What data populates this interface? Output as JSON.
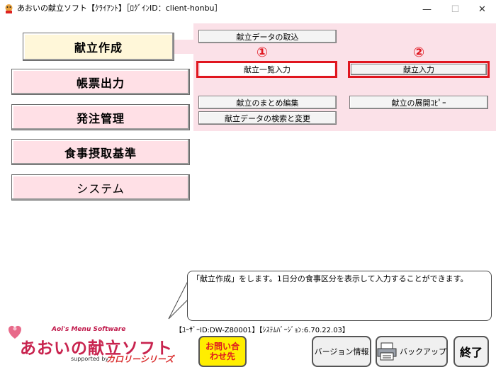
{
  "window": {
    "title": "あおいの献立ソフト【ｸﾗｲｱﾝﾄ】［ﾛｸﾞｲﾝID：client-honbu］",
    "minimize_glyph": "—",
    "maximize_glyph": "☐",
    "close_glyph": "✕"
  },
  "menu": {
    "items": [
      {
        "label": "献立作成"
      },
      {
        "label": "帳票出力"
      },
      {
        "label": "発注管理"
      },
      {
        "label": "食事摂取基準"
      },
      {
        "label": "システム"
      }
    ]
  },
  "submenu": {
    "import_label": "献立データの取込",
    "list_input_label": "献立一覧入力",
    "input_label": "献立入力",
    "bulk_edit_label": "献立のまとめ編集",
    "expand_copy_label": "献立の展開ｺﾋﾟｰ",
    "search_change_label": "献立データの検索と変更",
    "marker_1": "①",
    "marker_2": "②",
    "highlight_color": "#e0161f"
  },
  "hint": {
    "text": "「献立作成」をします。1日分の食事区分を表示して入力することができます。"
  },
  "status": {
    "user_info": "【ﾕｰｻﾞｰID:DW-Z80001】【ｼｽﾃﾑﾊﾞｰｼﾞｮﾝ:6.70.22.03】"
  },
  "logo": {
    "english": "Aoi's Menu Software",
    "japanese": "あおいの献立ソフト",
    "supported_by": "supported by",
    "series": "カロリーシリーズ"
  },
  "footer": {
    "contact_label": "お問い合わせ先",
    "version_label": "バージョン情報",
    "backup_label": "バックアップ",
    "exit_label": "終了"
  }
}
